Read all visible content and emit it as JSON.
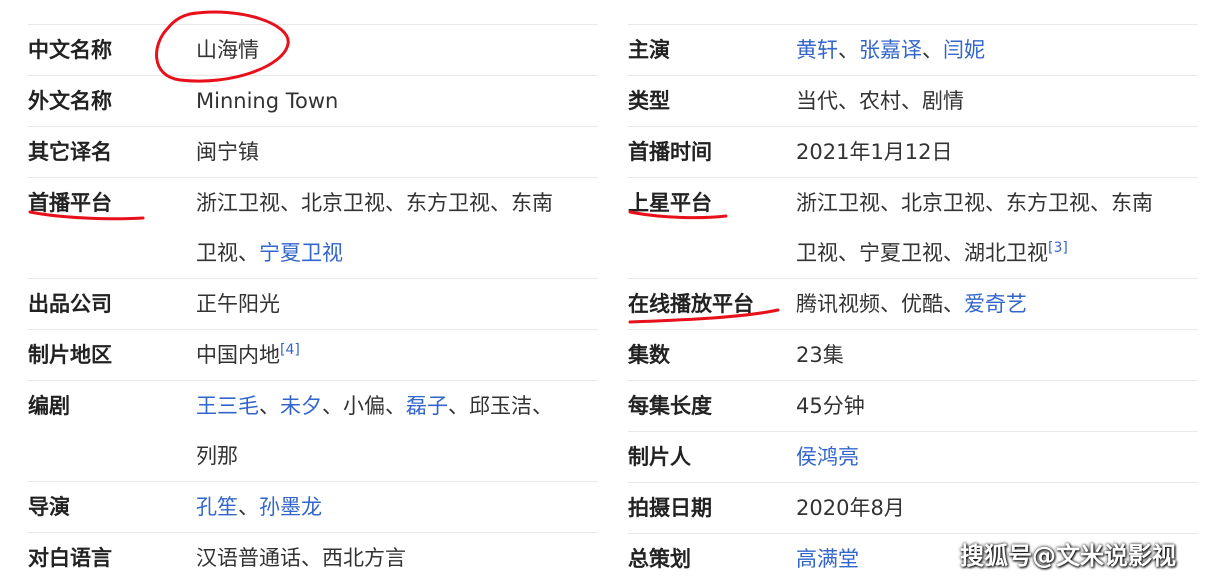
{
  "left": {
    "r1": {
      "label": "中文名称",
      "value": "山海情"
    },
    "r2": {
      "label": "外文名称",
      "value": "Minning Town"
    },
    "r3": {
      "label": "其它译名",
      "value": "闽宁镇"
    },
    "r4": {
      "label": "首播平台",
      "v1": "浙江卫视、北京卫视、东方卫视、东南",
      "v2": "卫视、",
      "v2link": "宁夏卫视"
    },
    "r5": {
      "label": "出品公司",
      "value": "正午阳光"
    },
    "r6": {
      "label": "制片地区",
      "value": "中国内地",
      "ref": "[4]"
    },
    "r7": {
      "label": "编剧",
      "l1": "王三毛",
      "s1": "、",
      "l2": "未夕",
      "s2": "、小偏、",
      "l3": "磊子",
      "s3": "、邱玉洁、",
      "v2": "列那"
    },
    "r8": {
      "label": "导演",
      "l1": "孔笙",
      "s1": "、",
      "l2": "孙墨龙"
    },
    "r9": {
      "label": "对白语言",
      "value": "汉语普通话、西北方言"
    }
  },
  "right": {
    "r1": {
      "label": "主演",
      "l1": "黄轩",
      "s1": "、",
      "l2": "张嘉译",
      "s2": "、",
      "l3": "闫妮"
    },
    "r2": {
      "label": "类型",
      "value": "当代、农村、剧情"
    },
    "r3": {
      "label": "首播时间",
      "value": "2021年1月12日"
    },
    "r4": {
      "label": "上星平台",
      "v1": "浙江卫视、北京卫视、东方卫视、东南",
      "v2": "卫视、宁夏卫视、湖北卫视",
      "ref": "[3]"
    },
    "r5": {
      "label": "在线播放平台",
      "v1": "腾讯视频、优酷、",
      "l1": "爱奇艺"
    },
    "r6": {
      "label": "集数",
      "value": "23集"
    },
    "r7": {
      "label": "每集长度",
      "value": "45分钟"
    },
    "r8": {
      "label": "制片人",
      "l1": "侯鸿亮"
    },
    "r9": {
      "label": "拍摄日期",
      "value": "2020年8月"
    },
    "r10": {
      "label": "总策划",
      "l1": "高满堂"
    }
  },
  "watermark": "搜狐号@文米说影视",
  "colors": {
    "link": "#3366cc",
    "annotation": "#e8101a"
  }
}
